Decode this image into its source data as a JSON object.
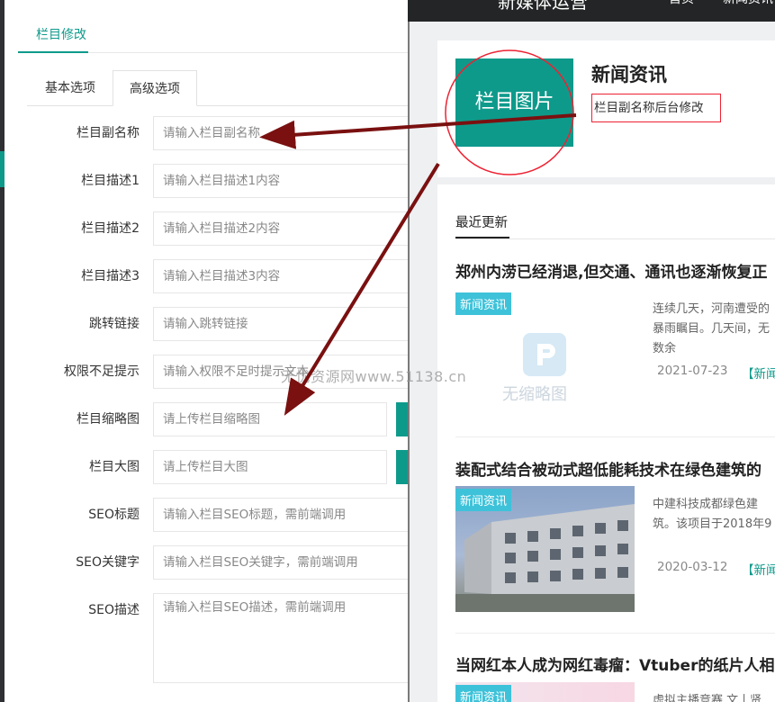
{
  "page_tab": "栏目修改",
  "subtabs": [
    "基本选项",
    "高级选项"
  ],
  "fields": [
    {
      "label": "栏目副名称",
      "placeholder": "请输入栏目副名称"
    },
    {
      "label": "栏目描述1",
      "placeholder": "请输入栏目描述1内容"
    },
    {
      "label": "栏目描述2",
      "placeholder": "请输入栏目描述2内容"
    },
    {
      "label": "栏目描述3",
      "placeholder": "请输入栏目描述3内容"
    },
    {
      "label": "跳转链接",
      "placeholder": "请输入跳转链接"
    },
    {
      "label": "权限不足提示",
      "placeholder": "请输入权限不足时提示文本"
    },
    {
      "label": "栏目缩略图",
      "placeholder": "请上传栏目缩略图"
    },
    {
      "label": "栏目大图",
      "placeholder": "请上传栏目大图"
    },
    {
      "label": "SEO标题",
      "placeholder": "请输入栏目SEO标题，需前端调用"
    },
    {
      "label": "SEO关键字",
      "placeholder": "请输入栏目SEO关键字，需前端调用"
    },
    {
      "label": "SEO描述",
      "placeholder": "请输入栏目SEO描述，需前端调用"
    }
  ],
  "watermark": "无忧资源网www.51138.cn",
  "preview": {
    "site_title": "新媒体运营",
    "nav": [
      "首页",
      "新闻资讯"
    ],
    "category_image_label": "栏目图片",
    "category_title": "新闻资讯",
    "category_subtitle": "栏目副名称后台修改",
    "recent_title": "最近更新",
    "articles": [
      {
        "title": "郑州内涝已经消退,但交通、通讯也逐渐恢复正",
        "tag": "新闻资讯",
        "summary": "连续几天，河南遭受的暴雨瞩目。几天间，无数余",
        "date": "2021-07-23",
        "more": "【新闻",
        "placeholder_text": "无缩略图"
      },
      {
        "title": "装配式结合被动式超低能耗技术在绿色建筑的",
        "tag": "新闻资讯",
        "summary": "中建科技成都绿色建筑。该项目于2018年9",
        "date": "2020-03-12",
        "more": "【新闻"
      },
      {
        "title": "当网红本人成为网红毒瘤：Vtuber的纸片人相",
        "tag": "新闻资讯",
        "summary": "虚拟主播竞赛 文丨贤"
      }
    ]
  },
  "colors": {
    "primary": "#0e9a8b",
    "tag": "#3ec2d9",
    "annotation_arrow": "#7a1010",
    "annotation_box": "#e22233"
  }
}
